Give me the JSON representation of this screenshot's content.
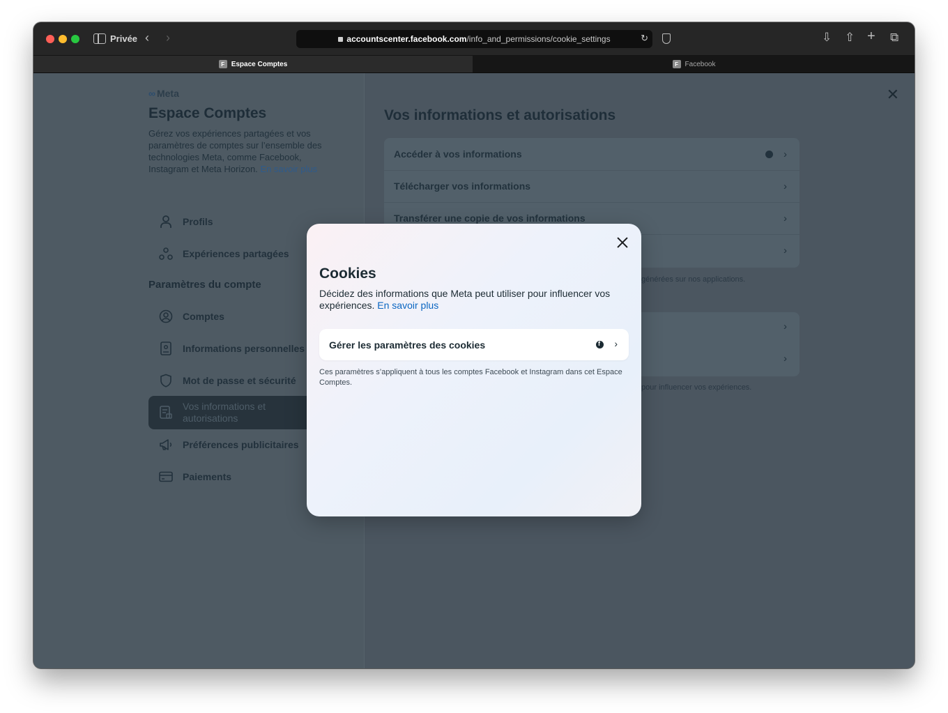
{
  "browser": {
    "private_label": "Privée",
    "url_host": "accountscenter.facebook.com",
    "url_path": "/info_and_permissions/cookie_settings",
    "tabs": [
      {
        "label": "Espace Comptes",
        "favicon": "F"
      },
      {
        "label": "Facebook",
        "favicon": "F"
      }
    ]
  },
  "sidebar": {
    "brand": "Meta",
    "title": "Espace Comptes",
    "description": "Gérez vos expériences partagées et vos paramètres de comptes sur l’ensemble des technologies Meta, comme Facebook, Instagram et Meta Horizon.",
    "learn_more": "En savoir plus",
    "top_items": [
      {
        "label": "Profils",
        "icon": "person-icon"
      },
      {
        "label": "Expériences partagées",
        "icon": "shared-experiences-icon"
      }
    ],
    "section_title": "Paramètres du compte",
    "items": [
      {
        "label": "Comptes",
        "icon": "account-circle-icon"
      },
      {
        "label": "Informations personnelles",
        "icon": "id-card-icon"
      },
      {
        "label": "Mot de passe et sécurité",
        "icon": "shield-icon"
      },
      {
        "label": "Vos informations et autorisations",
        "icon": "info-permissions-icon"
      },
      {
        "label": "Préférences publicitaires",
        "icon": "megaphone-icon"
      },
      {
        "label": "Paiements",
        "icon": "credit-card-icon"
      }
    ]
  },
  "main": {
    "title": "Vos informations et autorisations",
    "rows": [
      {
        "label": "Accéder à vos informations"
      },
      {
        "label": "Télécharger vos informations"
      },
      {
        "label": "Transférer une copie de vos informations"
      }
    ],
    "note1": "générées sur nos applications.",
    "note2": "pour influencer vos expériences."
  },
  "modal": {
    "title": "Cookies",
    "description": "Décidez des informations que Meta peut utiliser pour influencer vos expériences.",
    "learn_more": "En savoir plus",
    "option_label": "Gérer les paramètres des cookies",
    "note": "Ces paramètres s’appliquent à tous les comptes Facebook et Instagram dans cet Espace Comptes."
  },
  "colors": {
    "link": "#0a66c2",
    "overlay": "#4b5660"
  }
}
